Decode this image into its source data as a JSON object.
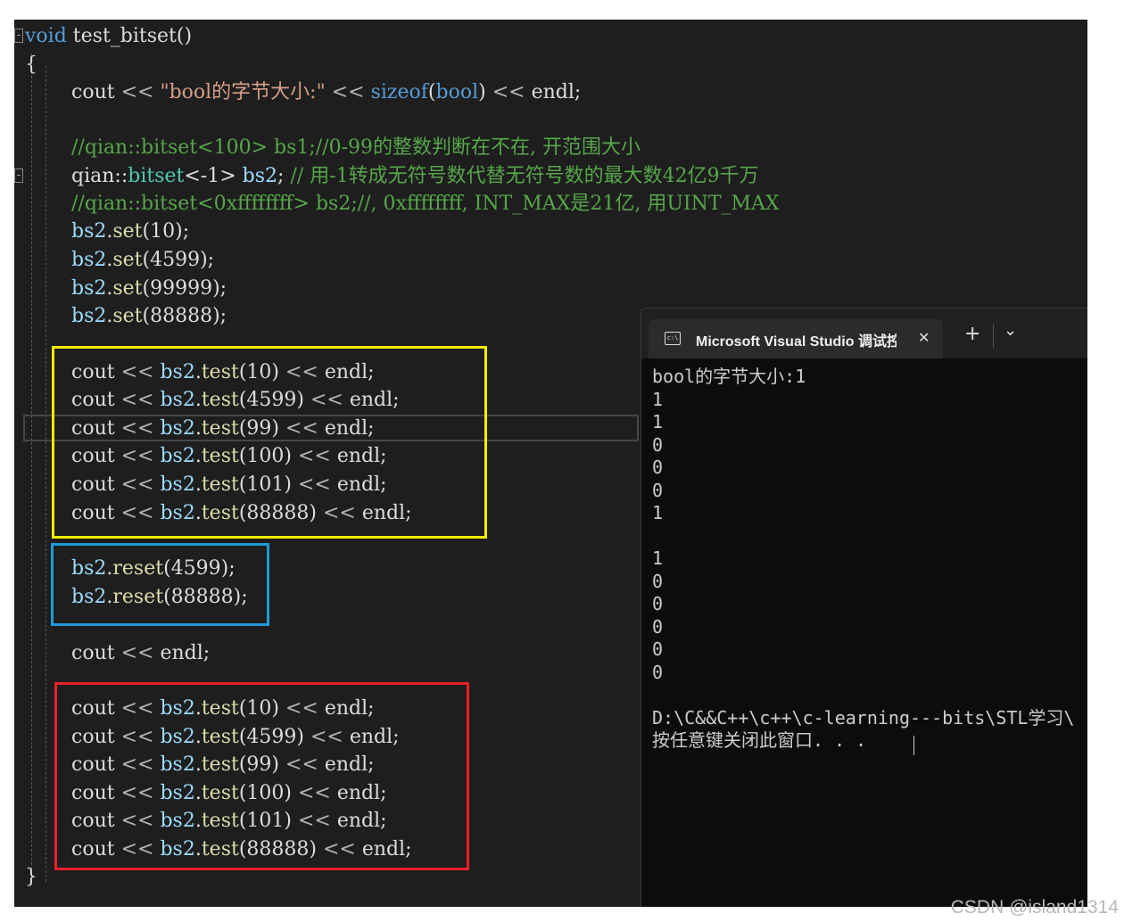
{
  "editor": {
    "lines": [
      {
        "top": 0,
        "tokens": [
          [
            "kw",
            "void"
          ],
          [
            "plain",
            " test_bitset()"
          ]
        ]
      },
      {
        "top": 0,
        "tokens": [
          [
            "plain",
            "{"
          ]
        ]
      },
      {
        "top": 0,
        "tokens": [
          [
            "plain",
            "cout "
          ],
          [
            "op",
            "<<"
          ],
          [
            "plain",
            " "
          ],
          [
            "str",
            "\"bool的字节大小:\""
          ],
          [
            "plain",
            " "
          ],
          [
            "op",
            "<<"
          ],
          [
            "plain",
            " "
          ],
          [
            "kw",
            "sizeof"
          ],
          [
            "plain",
            "("
          ],
          [
            "kw",
            "bool"
          ],
          [
            "plain",
            ") "
          ],
          [
            "op",
            "<<"
          ],
          [
            "plain",
            " endl;"
          ]
        ]
      },
      {
        "top": 0,
        "tokens": [
          [
            "cmt",
            "//qian::bitset<100> bs1;//0-99的整数判断在不在, 开范围大小"
          ]
        ]
      },
      {
        "top": 0,
        "tokens": [
          [
            "plain",
            "qian::"
          ],
          [
            "typ",
            "bitset"
          ],
          [
            "plain",
            "<-1> "
          ],
          [
            "vr",
            "bs2"
          ],
          [
            "plain",
            "; "
          ],
          [
            "cmt",
            "// 用-1转成无符号数代替无符号数的最大数42亿9千万"
          ]
        ]
      },
      {
        "top": 0,
        "tokens": [
          [
            "cmt",
            "//qian::bitset<0xffffffff> bs2;//, 0xffffffff, INT_MAX是21亿, 用UINT_MAX"
          ]
        ]
      },
      {
        "top": 0,
        "tokens": [
          [
            "vr",
            "bs2"
          ],
          [
            "plain",
            "."
          ],
          [
            "fn",
            "set"
          ],
          [
            "plain",
            "(10);"
          ]
        ]
      },
      {
        "top": 0,
        "tokens": [
          [
            "vr",
            "bs2"
          ],
          [
            "plain",
            "."
          ],
          [
            "fn",
            "set"
          ],
          [
            "plain",
            "(4599);"
          ]
        ]
      },
      {
        "top": 0,
        "tokens": [
          [
            "vr",
            "bs2"
          ],
          [
            "plain",
            "."
          ],
          [
            "fn",
            "set"
          ],
          [
            "plain",
            "(99999);"
          ]
        ]
      },
      {
        "top": 0,
        "tokens": [
          [
            "vr",
            "bs2"
          ],
          [
            "plain",
            "."
          ],
          [
            "fn",
            "set"
          ],
          [
            "plain",
            "(88888);"
          ]
        ]
      },
      {
        "top": 0,
        "tokens": [
          [
            "plain",
            "cout "
          ],
          [
            "op",
            "<<"
          ],
          [
            "plain",
            " "
          ],
          [
            "vr",
            "bs2"
          ],
          [
            "plain",
            "."
          ],
          [
            "fn",
            "test"
          ],
          [
            "plain",
            "(10) "
          ],
          [
            "op",
            "<<"
          ],
          [
            "plain",
            " endl;"
          ]
        ]
      },
      {
        "top": 0,
        "tokens": [
          [
            "plain",
            "cout "
          ],
          [
            "op",
            "<<"
          ],
          [
            "plain",
            " "
          ],
          [
            "vr",
            "bs2"
          ],
          [
            "plain",
            "."
          ],
          [
            "fn",
            "test"
          ],
          [
            "plain",
            "(4599) "
          ],
          [
            "op",
            "<<"
          ],
          [
            "plain",
            " endl;"
          ]
        ]
      },
      {
        "top": 0,
        "tokens": [
          [
            "plain",
            "cout "
          ],
          [
            "op",
            "<<"
          ],
          [
            "plain",
            " "
          ],
          [
            "vr",
            "bs2"
          ],
          [
            "plain",
            "."
          ],
          [
            "fn",
            "test"
          ],
          [
            "plain",
            "(99) "
          ],
          [
            "op",
            "<<"
          ],
          [
            "plain",
            " endl;"
          ]
        ]
      },
      {
        "top": 0,
        "tokens": [
          [
            "plain",
            "cout "
          ],
          [
            "op",
            "<<"
          ],
          [
            "plain",
            " "
          ],
          [
            "vr",
            "bs2"
          ],
          [
            "plain",
            "."
          ],
          [
            "fn",
            "test"
          ],
          [
            "plain",
            "(100) "
          ],
          [
            "op",
            "<<"
          ],
          [
            "plain",
            " endl;"
          ]
        ]
      },
      {
        "top": 0,
        "tokens": [
          [
            "plain",
            "cout "
          ],
          [
            "op",
            "<<"
          ],
          [
            "plain",
            " "
          ],
          [
            "vr",
            "bs2"
          ],
          [
            "plain",
            "."
          ],
          [
            "fn",
            "test"
          ],
          [
            "plain",
            "(101) "
          ],
          [
            "op",
            "<<"
          ],
          [
            "plain",
            " endl;"
          ]
        ]
      },
      {
        "top": 0,
        "tokens": [
          [
            "plain",
            "cout "
          ],
          [
            "op",
            "<<"
          ],
          [
            "plain",
            " "
          ],
          [
            "vr",
            "bs2"
          ],
          [
            "plain",
            "."
          ],
          [
            "fn",
            "test"
          ],
          [
            "plain",
            "(88888) "
          ],
          [
            "op",
            "<<"
          ],
          [
            "plain",
            " endl;"
          ]
        ]
      },
      {
        "top": 0,
        "tokens": [
          [
            "vr",
            "bs2"
          ],
          [
            "plain",
            "."
          ],
          [
            "fn",
            "reset"
          ],
          [
            "plain",
            "(4599);"
          ]
        ]
      },
      {
        "top": 0,
        "tokens": [
          [
            "vr",
            "bs2"
          ],
          [
            "plain",
            "."
          ],
          [
            "fn",
            "reset"
          ],
          [
            "plain",
            "(88888);"
          ]
        ]
      },
      {
        "top": 0,
        "tokens": [
          [
            "plain",
            "cout "
          ],
          [
            "op",
            "<<"
          ],
          [
            "plain",
            " endl;"
          ]
        ]
      },
      {
        "top": 0,
        "tokens": [
          [
            "plain",
            "cout "
          ],
          [
            "op",
            "<<"
          ],
          [
            "plain",
            " "
          ],
          [
            "vr",
            "bs2"
          ],
          [
            "plain",
            "."
          ],
          [
            "fn",
            "test"
          ],
          [
            "plain",
            "(10) "
          ],
          [
            "op",
            "<<"
          ],
          [
            "plain",
            " endl;"
          ]
        ]
      },
      {
        "top": 0,
        "tokens": [
          [
            "plain",
            "cout "
          ],
          [
            "op",
            "<<"
          ],
          [
            "plain",
            " "
          ],
          [
            "vr",
            "bs2"
          ],
          [
            "plain",
            "."
          ],
          [
            "fn",
            "test"
          ],
          [
            "plain",
            "(4599) "
          ],
          [
            "op",
            "<<"
          ],
          [
            "plain",
            " endl;"
          ]
        ]
      },
      {
        "top": 0,
        "tokens": [
          [
            "plain",
            "cout "
          ],
          [
            "op",
            "<<"
          ],
          [
            "plain",
            " "
          ],
          [
            "vr",
            "bs2"
          ],
          [
            "plain",
            "."
          ],
          [
            "fn",
            "test"
          ],
          [
            "plain",
            "(99) "
          ],
          [
            "op",
            "<<"
          ],
          [
            "plain",
            " endl;"
          ]
        ]
      },
      {
        "top": 0,
        "tokens": [
          [
            "plain",
            "cout "
          ],
          [
            "op",
            "<<"
          ],
          [
            "plain",
            " "
          ],
          [
            "vr",
            "bs2"
          ],
          [
            "plain",
            "."
          ],
          [
            "fn",
            "test"
          ],
          [
            "plain",
            "(100) "
          ],
          [
            "op",
            "<<"
          ],
          [
            "plain",
            " endl;"
          ]
        ]
      },
      {
        "top": 0,
        "tokens": [
          [
            "plain",
            "cout "
          ],
          [
            "op",
            "<<"
          ],
          [
            "plain",
            " "
          ],
          [
            "vr",
            "bs2"
          ],
          [
            "plain",
            "."
          ],
          [
            "fn",
            "test"
          ],
          [
            "plain",
            "(101) "
          ],
          [
            "op",
            "<<"
          ],
          [
            "plain",
            " endl;"
          ]
        ]
      },
      {
        "top": 0,
        "tokens": [
          [
            "plain",
            "cout "
          ],
          [
            "op",
            "<<"
          ],
          [
            "plain",
            " "
          ],
          [
            "vr",
            "bs2"
          ],
          [
            "plain",
            "."
          ],
          [
            "fn",
            "test"
          ],
          [
            "plain",
            "(88888) "
          ],
          [
            "op",
            "<<"
          ],
          [
            "plain",
            " endl;"
          ]
        ]
      },
      {
        "top": 0,
        "tokens": [
          [
            "plain",
            "}"
          ]
        ]
      }
    ],
    "highlight_colors": {
      "yellow": "#ffeb00",
      "blue": "#1e9bd7",
      "red": "#e8202a"
    }
  },
  "terminal": {
    "tab_title": "Microsoft Visual Studio 调试控",
    "close_glyph": "✕",
    "new_tab_glyph": "+",
    "dropdown_glyph": "⌄",
    "output_lines": [
      "bool的字节大小:1",
      "1",
      "1",
      "0",
      "0",
      "0",
      "1",
      "",
      "1",
      "0",
      "0",
      "0",
      "0",
      "0",
      "",
      "D:\\C&&C++\\c++\\c-learning---bits\\STL学习\\",
      "按任意键关闭此窗口. . ."
    ]
  },
  "watermark": "CSDN @island1314"
}
